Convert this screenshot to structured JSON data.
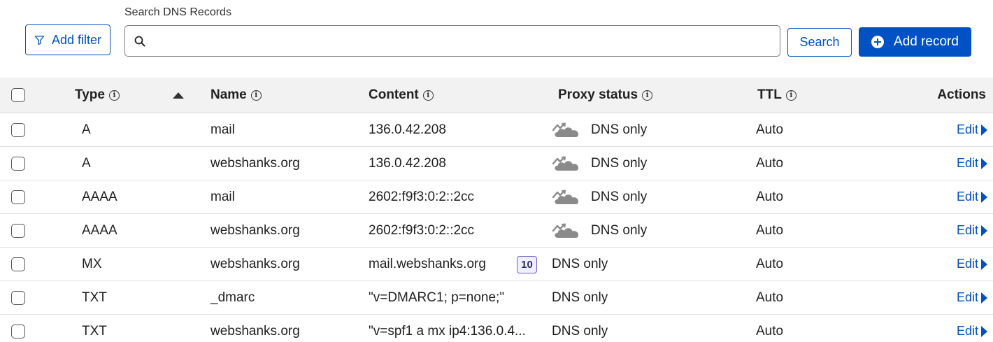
{
  "toolbar": {
    "add_filter_label": "Add filter",
    "search_label": "Search DNS Records",
    "search_value": "",
    "search_placeholder": "",
    "search_button_label": "Search",
    "add_record_label": "Add record"
  },
  "table": {
    "columns": {
      "type": "Type",
      "name": "Name",
      "content": "Content",
      "proxy_status": "Proxy status",
      "ttl": "TTL",
      "actions": "Actions"
    },
    "sort": {
      "column": "type",
      "direction": "ascending"
    },
    "rows": [
      {
        "type": "A",
        "name": "mail",
        "content": "136.0.42.208",
        "proxy_status": "DNS only",
        "proxy_icon": "cloud-dns-only-icon",
        "ttl": "Auto",
        "action": "Edit"
      },
      {
        "type": "A",
        "name": "webshanks.org",
        "content": "136.0.42.208",
        "proxy_status": "DNS only",
        "proxy_icon": "cloud-dns-only-icon",
        "ttl": "Auto",
        "action": "Edit"
      },
      {
        "type": "AAAA",
        "name": "mail",
        "content": "2602:f9f3:0:2::2cc",
        "proxy_status": "DNS only",
        "proxy_icon": "cloud-dns-only-icon",
        "ttl": "Auto",
        "action": "Edit"
      },
      {
        "type": "AAAA",
        "name": "webshanks.org",
        "content": "2602:f9f3:0:2::2cc",
        "proxy_status": "DNS only",
        "proxy_icon": "cloud-dns-only-icon",
        "ttl": "Auto",
        "action": "Edit"
      },
      {
        "type": "MX",
        "name": "webshanks.org",
        "content": "mail.webshanks.org",
        "priority": "10",
        "proxy_status": "DNS only",
        "ttl": "Auto",
        "action": "Edit"
      },
      {
        "type": "TXT",
        "name": "_dmarc",
        "content": "\"v=DMARC1; p=none;\"",
        "proxy_status": "DNS only",
        "ttl": "Auto",
        "action": "Edit"
      },
      {
        "type": "TXT",
        "name": "webshanks.org",
        "content": "\"v=spf1 a mx ip4:136.0.4...",
        "proxy_status": "DNS only",
        "ttl": "Auto",
        "action": "Edit"
      }
    ]
  },
  "colors": {
    "accent": "#0051c3",
    "header_bg": "#f2f2f2",
    "cloud_gray": "#8a8a8a",
    "priority_border": "#6b5fd0"
  }
}
